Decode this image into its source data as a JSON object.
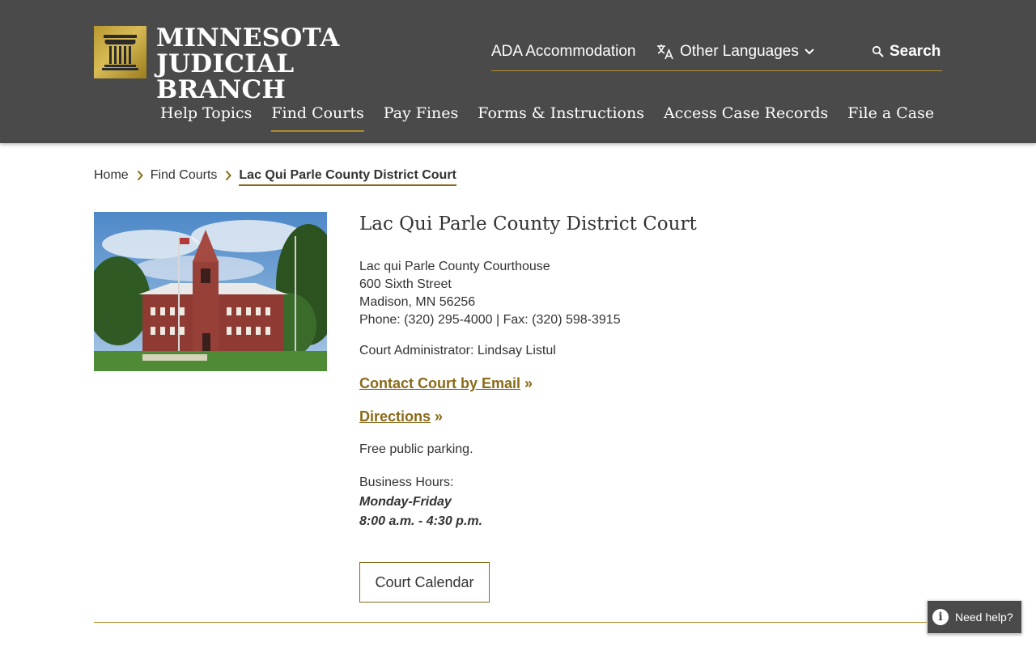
{
  "header": {
    "logo_line1": "MINNESOTA",
    "logo_line2": "JUDICIAL BRANCH",
    "util": {
      "ada": "ADA Accommodation",
      "languages": "Other Languages",
      "search": "Search"
    },
    "nav": [
      {
        "label": "Help Topics"
      },
      {
        "label": "Find Courts"
      },
      {
        "label": "Pay Fines"
      },
      {
        "label": "Forms & Instructions"
      },
      {
        "label": "Access Case Records"
      },
      {
        "label": "File a Case"
      }
    ],
    "active_nav": "Find Courts"
  },
  "breadcrumb": [
    {
      "label": "Home"
    },
    {
      "label": "Find Courts"
    },
    {
      "label": "Lac Qui Parle County District Court"
    }
  ],
  "court": {
    "title": "Lac Qui Parle County District Court",
    "building": "Lac qui Parle County Courthouse",
    "street": "600 Sixth Street",
    "city": "Madison, MN 56256",
    "phone_fax": "Phone: (320) 295-4000 | Fax: (320) 598-3915",
    "administrator": "Court Administrator: Lindsay Listul",
    "contact_link": "Contact Court by Email",
    "directions_link": "Directions",
    "link_suffix": "»",
    "parking": "Free public parking.",
    "hours_label": "Business Hours:",
    "hours_days": "Monday-Friday",
    "hours_time": "8:00 a.m. - 4:30 p.m.",
    "calendar_button": "Court Calendar"
  },
  "help_button": "Need help?",
  "colors": {
    "header_bg": "#4a4a4a",
    "accent_gold": "#8a6a18",
    "rule_gold": "#b38c2a"
  }
}
